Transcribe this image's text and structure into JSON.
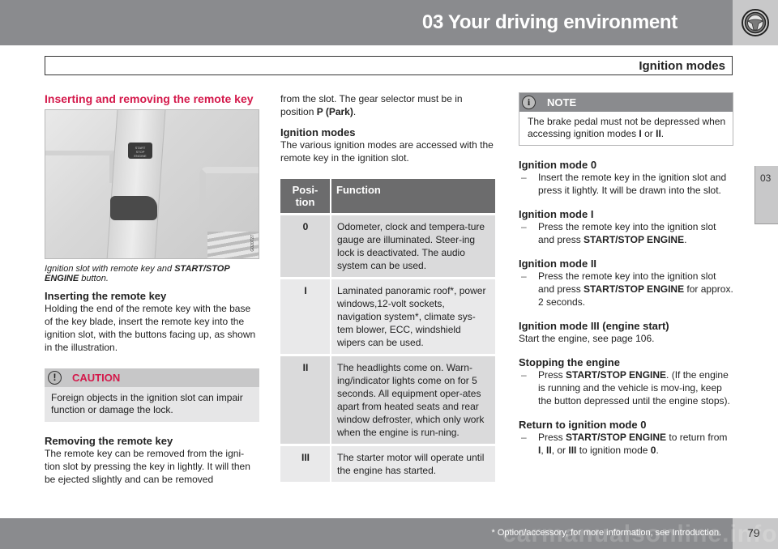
{
  "header": {
    "chapter_title": "03 Your driving environment",
    "section_title": "Ignition modes",
    "icon": "steering-wheel-icon"
  },
  "side_tab": {
    "label": "03"
  },
  "column1": {
    "section_title": "Inserting and removing the remote key",
    "image": {
      "description": "Ignition slot with remote key and START/STOP ENGINE button",
      "button_text": [
        "START",
        "STOP",
        "ENGINE"
      ],
      "code": "G020727"
    },
    "caption_pre": "Ignition slot with remote key and ",
    "caption_bold": "START/STOP ENGINE",
    "caption_post": " button.",
    "inserting_title": "Inserting the remote key",
    "inserting_body": "Holding the end of the remote key with the base of the key blade, insert the remote key into the ignition slot, with the buttons facing up, as shown in the illustration.",
    "caution": {
      "icon": "exclamation-circle-icon",
      "label": "CAUTION",
      "text": "Foreign objects in the ignition slot can impair function or damage the lock."
    },
    "removing_title": "Removing the remote key",
    "removing_body": "The remote key can be removed from the igni-tion slot by pressing the key in lightly. It will then be ejected slightly and can be removed"
  },
  "column2": {
    "continued_text_pre": "from the slot. The gear selector must be in position ",
    "continued_text_bold": "P (Park)",
    "continued_text_post": ".",
    "ignition_modes_title": "Ignition modes",
    "ignition_modes_body": "The various ignition modes are accessed with the remote key in the ignition slot.",
    "table": {
      "headers": [
        "Posi-tion",
        "Function"
      ],
      "rows": [
        {
          "position": "0",
          "function": "Odometer, clock and tempera-ture gauge are illuminated. Steer-ing lock is deactivated. The audio system can be used."
        },
        {
          "position": "I",
          "function": "Laminated panoramic roof*, power windows,12-volt sockets, navigation system*, climate sys-tem blower, ECC, windshield wipers can be used."
        },
        {
          "position": "II",
          "function": "The headlights come on. Warn-ing/indicator lights come on for 5 seconds. All equipment oper-ates apart from heated seats and rear window defroster, which only work when the engine is run-ning."
        },
        {
          "position": "III",
          "function": "The starter motor will operate until the engine has started."
        }
      ]
    }
  },
  "column3": {
    "note": {
      "icon": "info-circle-icon",
      "label": "NOTE",
      "text_pre": "The brake pedal must not be depressed when accessing ignition modes ",
      "text_b1": "I",
      "text_mid": " or ",
      "text_b2": "II",
      "text_post": "."
    },
    "modes": [
      {
        "title": "Ignition mode 0",
        "item": "Insert the remote key in the ignition slot and press it lightly. It will be drawn into the slot."
      },
      {
        "title": "Ignition mode I",
        "item_pre": "Press the remote key into the ignition slot and press ",
        "item_bold": "START/STOP ENGINE",
        "item_post": "."
      },
      {
        "title": "Ignition mode II",
        "item_pre": "Press the remote key into the ignition slot and press ",
        "item_bold": "START/STOP ENGINE",
        "item_post": " for approx. 2 seconds."
      },
      {
        "title": "Ignition mode III (engine start)",
        "text": "Start the engine, see page 106."
      },
      {
        "title": "Stopping the engine",
        "item_pre": "Press ",
        "item_bold": "START/STOP ENGINE",
        "item_post": ". (If the engine is running and the vehicle is mov-ing, keep the button depressed until the engine stops)."
      },
      {
        "title": "Return to ignition mode 0",
        "item_pre": "Press ",
        "item_bold": "START/STOP ENGINE",
        "item_post": " to return from ",
        "b1": "I",
        "s1": ", ",
        "b2": "II",
        "s2": ", or ",
        "b3": "III",
        "s3": " to ignition mode ",
        "b4": "0",
        "s4": "."
      }
    ]
  },
  "footer": {
    "continue_marker": "▸▸",
    "footnote": "* Option/accessory, for more information, see Introduction.",
    "page_number": "79",
    "watermark": "carmanualsonline.info"
  }
}
